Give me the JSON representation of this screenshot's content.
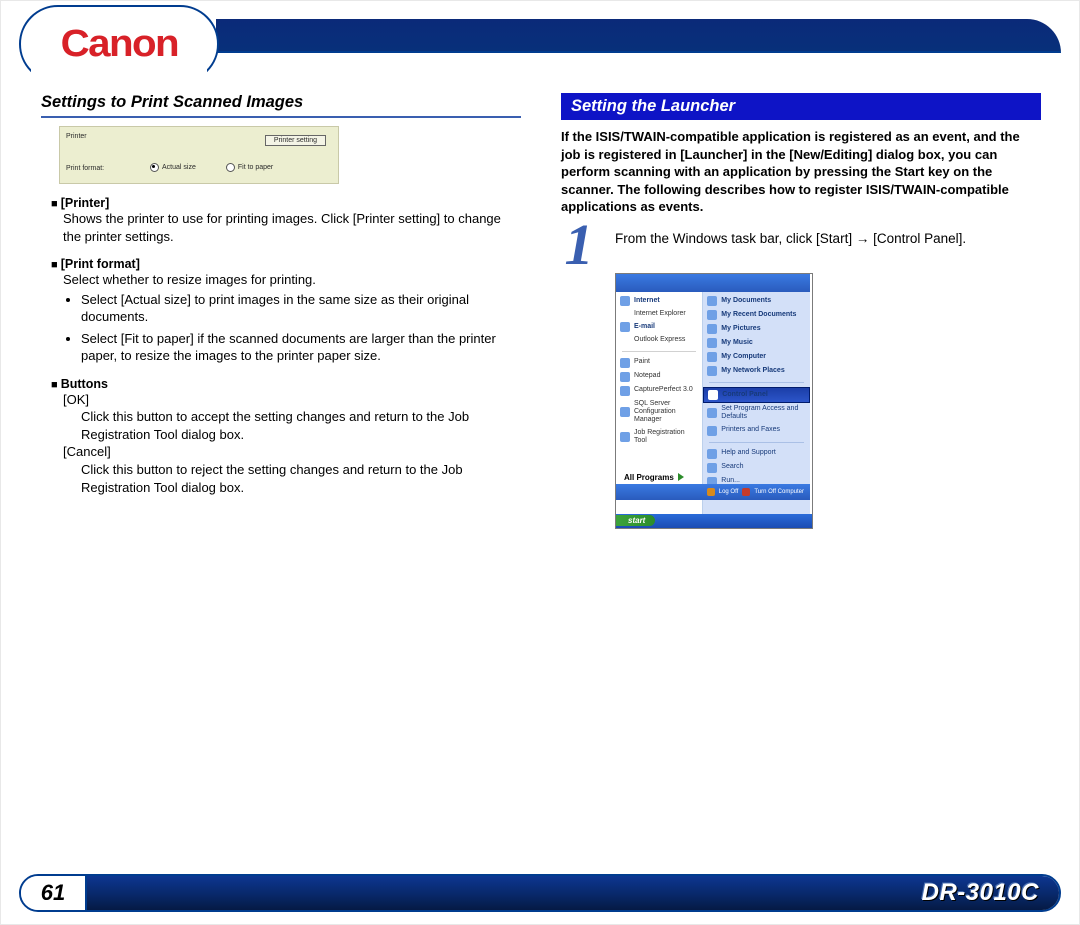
{
  "brand": "Canon",
  "model": "DR-3010C",
  "page_number": "61",
  "left": {
    "heading": "Settings to Print Scanned Images",
    "printer_panel": {
      "label_printer": "Printer",
      "label_print_format": "Print format:",
      "button_setting": "Printer setting",
      "radio_actual": "Actual size",
      "radio_fit": "Fit to paper"
    },
    "s1_head": "[Printer]",
    "s1_body": "Shows the printer to use for printing images. Click [Printer setting] to change the printer settings.",
    "s2_head": "[Print format]",
    "s2_body_lead": "Select whether to resize images for printing.",
    "s2_bullet1": "Select [Actual size] to print images in the same size as their original documents.",
    "s2_bullet2": "Select [Fit to paper] if the scanned documents are larger than the printer paper, to resize the images to the printer paper size.",
    "s3_head": "Buttons",
    "s3_ok_label": "[OK]",
    "s3_ok_body": "Click this button to accept the setting changes and return to the Job Registration Tool dialog box.",
    "s3_cancel_label": "[Cancel]",
    "s3_cancel_body": "Click this button to reject the setting changes and return to the Job Registration Tool dialog box."
  },
  "right": {
    "banner": "Setting the Launcher",
    "intro": "If the ISIS/TWAIN-compatible application is registered as an event, and the job is registered in [Launcher] in the [New/Editing] dialog box, you can perform scanning with an application by pressing the Start key on the scanner. The following describes how to register ISIS/TWAIN-compatible applications as events.",
    "step1_num": "1",
    "step1_text": "From the Windows task bar, click [Start] → [Control Panel].",
    "xp": {
      "internet": "Internet",
      "internet_sub": "Internet Explorer",
      "email": "E-mail",
      "email_sub": "Outlook Express",
      "paint": "Paint",
      "notepad": "Notepad",
      "capture": "CapturePerfect 3.0",
      "sql": "SQL Server Configuration Manager",
      "jobreg": "Job Registration Tool",
      "allprograms": "All Programs",
      "mydocs": "My Documents",
      "myrecent": "My Recent Documents",
      "mypics": "My Pictures",
      "mymusic": "My Music",
      "mycomp": "My Computer",
      "mynet": "My Network Places",
      "control": "Control Panel",
      "setprog": "Set Program Access and Defaults",
      "printers": "Printers and Faxes",
      "help": "Help and Support",
      "search": "Search",
      "run": "Run...",
      "logoff": "Log Off",
      "turnoff": "Turn Off Computer",
      "start": "start"
    }
  }
}
